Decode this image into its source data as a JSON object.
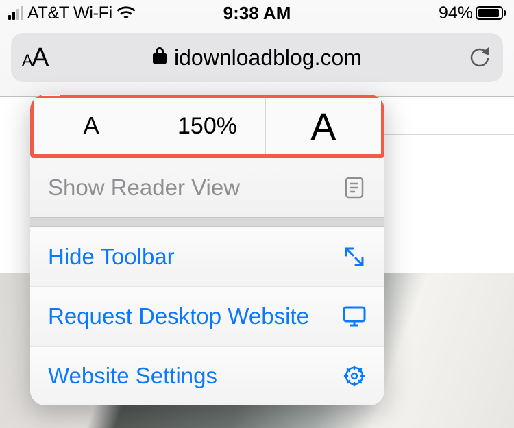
{
  "statusBar": {
    "carrier": "AT&T Wi-Fi",
    "time": "9:38 AM",
    "batteryPercent": "94%"
  },
  "urlBar": {
    "domain": "idownloadblog.com"
  },
  "popover": {
    "textSize": {
      "smallLabel": "A",
      "percentLabel": "150%",
      "bigLabel": "A"
    },
    "readerView": "Show Reader View",
    "hideToolbar": "Hide Toolbar",
    "requestDesktop": "Request Desktop Website",
    "websiteSettings": "Website Settings"
  },
  "colors": {
    "highlight": "#f15b47",
    "link": "#0a78ff",
    "disabled": "#8e8e93"
  }
}
